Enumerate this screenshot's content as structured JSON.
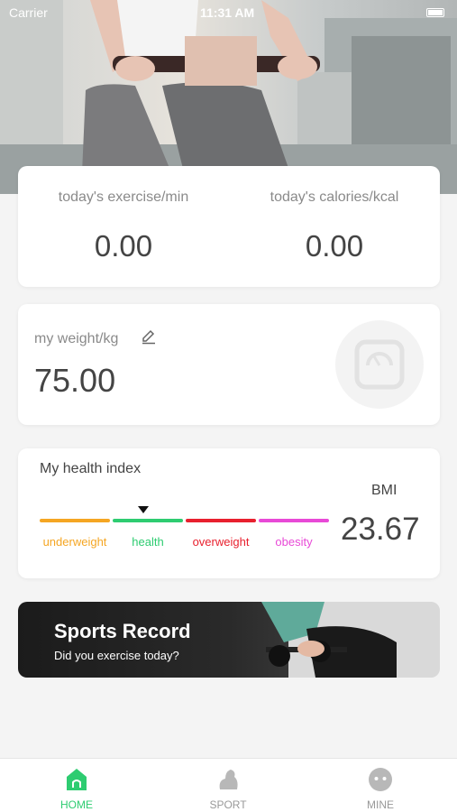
{
  "status_bar": {
    "carrier": "Carrier",
    "time": "11:31 AM"
  },
  "stats": {
    "exercise_label": "today's exercise/min",
    "exercise_value": "0.00",
    "calories_label": "today's calories/kcal",
    "calories_value": "0.00"
  },
  "weight": {
    "label": "my weight/kg",
    "value": "75.00"
  },
  "health": {
    "title": "My health index",
    "bmi_label": "BMI",
    "bmi_value": "23.67",
    "categories": [
      {
        "label": "underweight",
        "color": "#f5a623"
      },
      {
        "label": "health",
        "color": "#2ecc71"
      },
      {
        "label": "overweight",
        "color": "#e8202e"
      },
      {
        "label": "obesity",
        "color": "#e84ad7"
      }
    ]
  },
  "banner": {
    "title": "Sports Record",
    "subtitle": "Did you exercise today?"
  },
  "tabs": [
    {
      "label": "HOME",
      "icon": "home-icon",
      "active": true,
      "color": "#2ecc71"
    },
    {
      "label": "SPORT",
      "icon": "arm-icon",
      "active": false,
      "color": "#999999"
    },
    {
      "label": "MINE",
      "icon": "face-icon",
      "active": false,
      "color": "#999999"
    }
  ]
}
